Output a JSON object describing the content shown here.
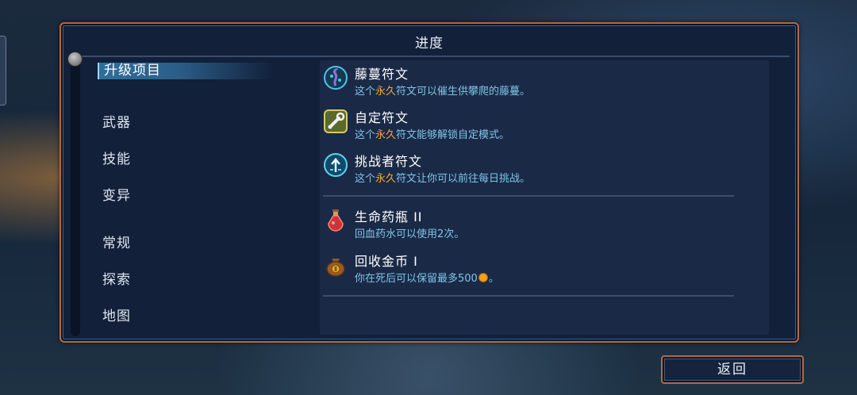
{
  "title": "进度",
  "nav": [
    {
      "label": "升级项目",
      "active": true
    },
    {
      "label": "武器"
    },
    {
      "label": "技能"
    },
    {
      "label": "变异"
    },
    {
      "label": "常规"
    },
    {
      "label": "探索"
    },
    {
      "label": "地图"
    }
  ],
  "runes": [
    {
      "name": "藤蔓符文",
      "desc_pre": "这个",
      "desc_hl": "永久",
      "desc_post": "符文可以催生供攀爬的藤蔓。",
      "icon": "vine-rune-icon"
    },
    {
      "name": "自定符文",
      "desc_pre": "这个",
      "desc_hl": "永久",
      "desc_post": "符文能够解锁自定模式。",
      "icon": "wrench-rune-icon"
    },
    {
      "name": "挑战者符文",
      "desc_pre": "这个",
      "desc_hl": "永久",
      "desc_post": "符文让你可以前往每日挑战。",
      "icon": "challenger-rune-icon"
    }
  ],
  "upgrades": [
    {
      "name": "生命药瓶 II",
      "desc": "回血药水可以使用2次。",
      "icon": "health-flask-icon"
    },
    {
      "name": "回收金币 I",
      "desc_pre": "你在死后可以保留最多500",
      "desc_post": "。",
      "icon": "gold-bag-icon",
      "coin_icon": "gold-coin-icon"
    }
  ],
  "back_button": "返回",
  "colors": {
    "highlight": "#f2a63a",
    "desc": "#7fc4ea",
    "frame": "#b06a45"
  }
}
